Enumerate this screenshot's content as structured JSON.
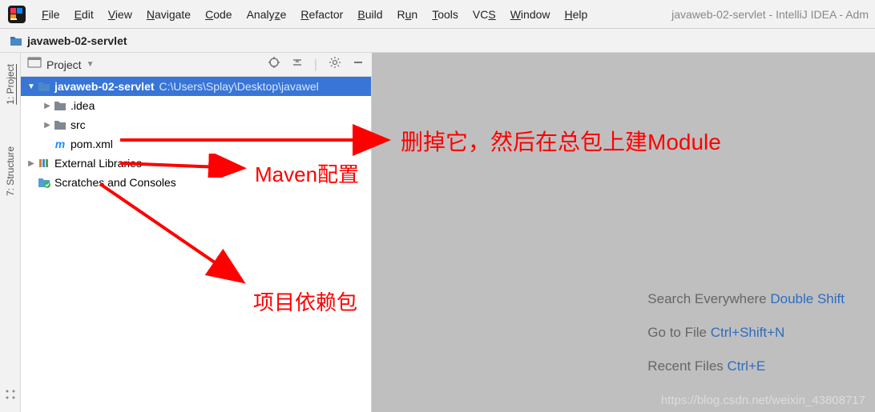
{
  "menubar": {
    "items": [
      "File",
      "Edit",
      "View",
      "Navigate",
      "Code",
      "Analyze",
      "Refactor",
      "Build",
      "Run",
      "Tools",
      "VCS",
      "Window",
      "Help"
    ],
    "mnemonics": [
      "F",
      "E",
      "V",
      "N",
      "C",
      "z",
      "R",
      "B",
      "u",
      "T",
      "S",
      "W",
      "H"
    ],
    "window_title": "javaweb-02-servlet - IntelliJ IDEA - Adm"
  },
  "navbar": {
    "crumb": "javaweb-02-servlet"
  },
  "side_tabs": {
    "project": "1: Project",
    "structure": "7: Structure"
  },
  "tool_header": {
    "title": "Project"
  },
  "tree": {
    "root": {
      "label": "javaweb-02-servlet",
      "path": "C:\\Users\\Splay\\Desktop\\javawel"
    },
    "idea": ".idea",
    "src": "src",
    "pom": "pom.xml",
    "external": "External Libraries",
    "scratches": "Scratches and Consoles"
  },
  "shortcuts": {
    "row1_text": "Search Everywhere ",
    "row1_key": "Double Shift",
    "row2_text": "Go to File ",
    "row2_key": "Ctrl+Shift+N",
    "row3_text": "Recent Files ",
    "row3_key": "Ctrl+E"
  },
  "annotations": {
    "a1": "删掉它，然后在总包上建Module",
    "a2": "Maven配置",
    "a3": "项目依赖包"
  },
  "watermark": "https://blog.csdn.net/weixin_43808717"
}
